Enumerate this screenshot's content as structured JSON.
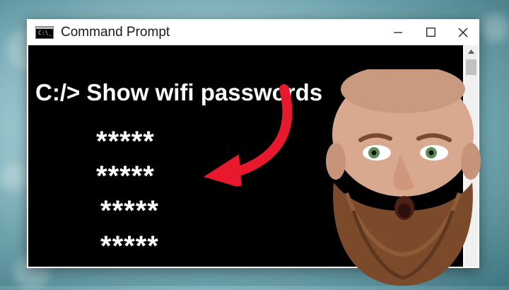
{
  "window": {
    "title": "Command Prompt",
    "icon": "cmd-icon",
    "icon_text": "C:\\_",
    "controls": [
      "minimize-icon",
      "maximize-icon",
      "close-icon"
    ]
  },
  "console": {
    "prompt": "C:/> Show wifi passwords",
    "passwords": [
      "*****",
      "*****",
      "*****",
      "*****"
    ]
  },
  "colors": {
    "console_bg": "#000000",
    "console_text": "#ffffff",
    "arrow": "#e8192c",
    "background": "#a9d1d8"
  }
}
